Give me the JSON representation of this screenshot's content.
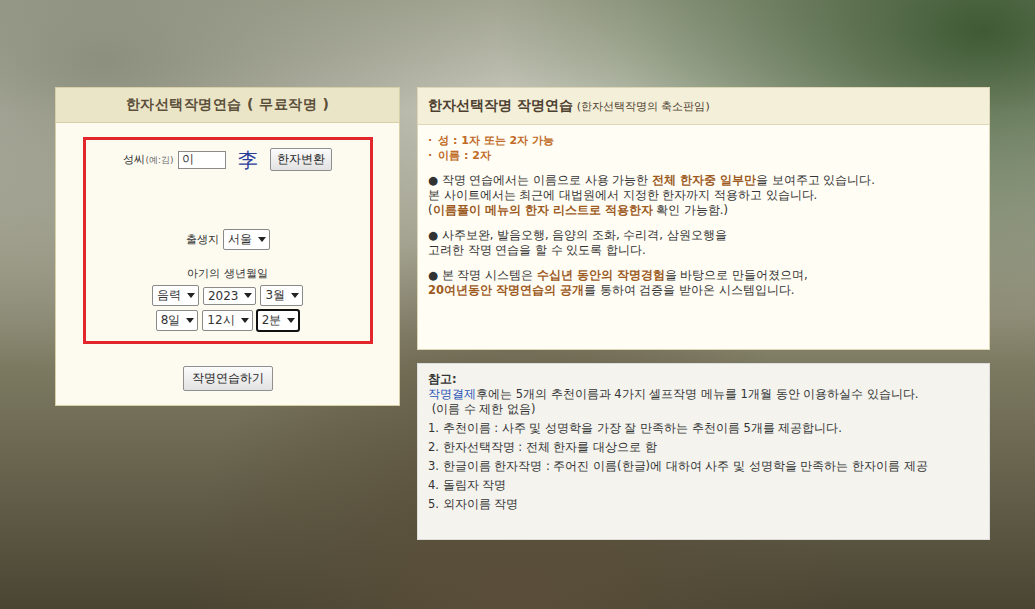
{
  "left_panel": {
    "title": "한자선택작명연습 ( 무료작명 )",
    "surname_label": "성씨",
    "surname_hint": "(예:김)",
    "surname_value": "이",
    "surname_hanja": "李",
    "convert_button": "한자변환",
    "birthplace_label": "출생지",
    "birthplace": "서울",
    "birthdate_label": "아기의 생년월일",
    "date_selects": [
      {
        "value": "음력",
        "focused": false
      },
      {
        "value": "2023",
        "focused": false
      },
      {
        "value": "3월",
        "focused": false
      }
    ],
    "time_selects": [
      {
        "value": "8일",
        "focused": false
      },
      {
        "value": "12시",
        "focused": false
      },
      {
        "value": "2분",
        "focused": true
      }
    ],
    "submit_button": "작명연습하기"
  },
  "info_panel": {
    "title": "한자선택작명 작명연습",
    "subtitle": "(한자선택작명의 축소판임)",
    "rules": [
      {
        "bullet": "·",
        "text": "성 : 1자 또는 2자 가능"
      },
      {
        "bullet": "·",
        "text": "이름 : 2자"
      }
    ],
    "paragraphs": [
      {
        "lines": [
          [
            {
              "text": "● 작명 연습에서는 이름으로 사용 가능한 ",
              "emphasis": false
            },
            {
              "text": "전체 한자중 일부만",
              "emphasis": true
            },
            {
              "text": "을 보여주고 있습니다.",
              "emphasis": false
            }
          ],
          [
            {
              "text": "본 사이트에서는 최근에 대법원에서 지정한 한자까지 적용하고 있습니다.",
              "emphasis": false
            }
          ],
          [
            {
              "text": "(",
              "emphasis": false
            },
            {
              "text": "이름풀이 메뉴의 한자 리스트로 적용한자",
              "emphasis": true
            },
            {
              "text": " 확인 가능함.)",
              "emphasis": false
            }
          ]
        ]
      },
      {
        "lines": [
          [
            {
              "text": "● 사주보완, 발음오행, 음양의 조화, 수리격, 삼원오행을",
              "emphasis": false
            }
          ],
          [
            {
              "text": "고려한 작명 연습을 할 수 있도록 합니다.",
              "emphasis": false
            }
          ]
        ]
      },
      {
        "lines": [
          [
            {
              "text": "● 본 작명 시스템은 ",
              "emphasis": false
            },
            {
              "text": "수십년 동안의 작명경험",
              "emphasis": true
            },
            {
              "text": "을 바탕으로 만들어졌으며,",
              "emphasis": false
            }
          ],
          [
            {
              "text": "20여년동안 작명연습의 공개",
              "emphasis": true
            },
            {
              "text": "를 통하여 검증을 받아온 시스템입니다.",
              "emphasis": false
            }
          ]
        ]
      }
    ]
  },
  "reference_panel": {
    "title": "참고:",
    "link": "작명결제",
    "intro": "후에는 5개의 추천이름과 4가지 셀프작명 메뉴를 1개월 동안 이용하실수 있습니다.",
    "note": " (이름 수 제한 없음)",
    "items": [
      "1. 추천이름 : 사주 및 성명학을 가장 잘 만족하는 추천이름 5개를 제공합니다.",
      "2. 한자선택작명 : 전체 한자를 대상으로 함",
      "3. 한글이름 한자작명 : 주어진 이름(한글)에 대하여 사주 및 성명학을 만족하는 한자이름 제공",
      "4. 돌림자 작명",
      "5. 외자이름 작명"
    ]
  }
}
